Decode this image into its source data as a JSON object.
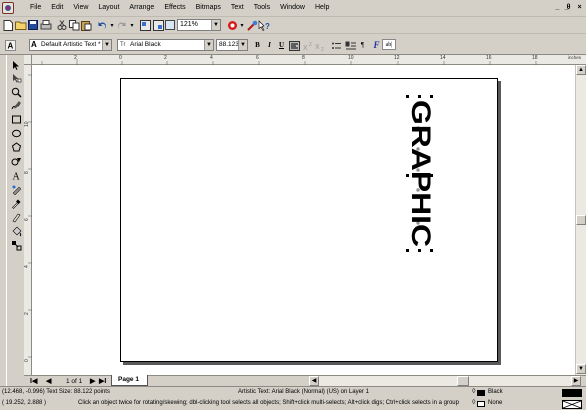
{
  "menubar": {
    "items": [
      "File",
      "Edit",
      "View",
      "Layout",
      "Arrange",
      "Effects",
      "Bitmaps",
      "Text",
      "Tools",
      "Window",
      "Help"
    ],
    "window_controls": [
      "_",
      "̲θ",
      "×"
    ]
  },
  "toolbar": {
    "zoom_value": "121%"
  },
  "propbar": {
    "preset_value": "Default Artistic Text *",
    "font_value": "Arial Black",
    "size_value": "88.123",
    "bold": "B",
    "italic": "I",
    "underline": "U",
    "format_char": "¶",
    "edit_text": "ab|",
    "f_label": "F"
  },
  "ruler": {
    "h_ticks": [
      "2",
      "0",
      "2",
      "4",
      "6",
      "8",
      "10",
      "12",
      "14",
      "16",
      "18"
    ],
    "units": "inches",
    "v_ticks": [
      "10",
      "8",
      "6",
      "4",
      "2",
      "0"
    ]
  },
  "canvas": {
    "text": "GRAPHIC"
  },
  "pagebar": {
    "first": "I◀",
    "prev": "◀",
    "count": "1 of 1",
    "next": "▶",
    "last": "▶I",
    "tab": "Page 1"
  },
  "statusbar": {
    "line1_left": "(12.468, -0.996) Text Size: 88.122 points",
    "line1_center": "Artistic Text: Arial Black (Normal) (US) on Layer 1",
    "line1_fill": "Black",
    "line2_left": "( 19.252, 2.888 )",
    "line2_hint": "Click an object twice for rotating/skewing; dbl-clicking tool selects all objects; Shift+click multi-selects; Alt+click digs; Ctrl+click selects in a group",
    "line2_outline": "None",
    "fill_color": "#000000",
    "outline_color": "#ffffff"
  }
}
